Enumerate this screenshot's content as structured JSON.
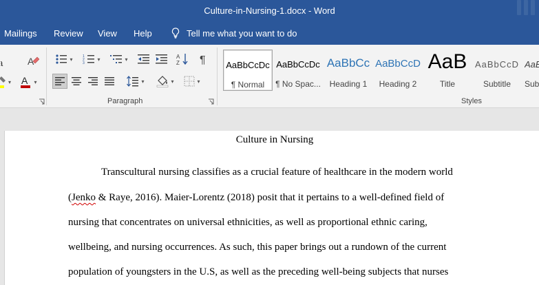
{
  "window": {
    "title": "Culture-in-Nursing-1.docx  -  Word"
  },
  "tabs": {
    "mailings": "Mailings",
    "review": "Review",
    "view": "View",
    "help": "Help",
    "tell_me": "Tell me what you want to do"
  },
  "ribbon": {
    "paragraph_label": "Paragraph",
    "styles_label": "Styles",
    "styles": [
      {
        "sample": "AaBbCcDc",
        "name": "¶ Normal"
      },
      {
        "sample": "AaBbCcDc",
        "name": "¶ No Spac..."
      },
      {
        "sample": "AaBbCc",
        "name": "Heading 1"
      },
      {
        "sample": "AaBbCcD",
        "name": "Heading 2"
      },
      {
        "sample": "AaB",
        "name": "Title"
      },
      {
        "sample": "AaBbCcD",
        "name": "Subtitle"
      },
      {
        "sample": "AaBl",
        "name": "Subt"
      }
    ],
    "colors": {
      "font_color": "#c00000",
      "highlight": "#ffff00",
      "title_bar": "#2b579a"
    }
  },
  "document": {
    "title": "Culture in Nursing",
    "lines": {
      "l1": "Transcultural nursing classifies as a crucial feature of healthcare in the modern world",
      "l2_open": "(",
      "l2_spell": "Jenko",
      "l2_rest": " & Raye, 2016). Maier-Lorentz (2018) posit that it pertains to a well-defined field of",
      "l3": "nursing that concentrates on universal ethnicities, as well as proportional ethnic caring,",
      "l4": "wellbeing, and nursing occurrences. As such, this paper brings out a rundown of the current",
      "l5": "population of youngsters in the U.S, as well as the preceding well-being subjects that nurses"
    }
  }
}
